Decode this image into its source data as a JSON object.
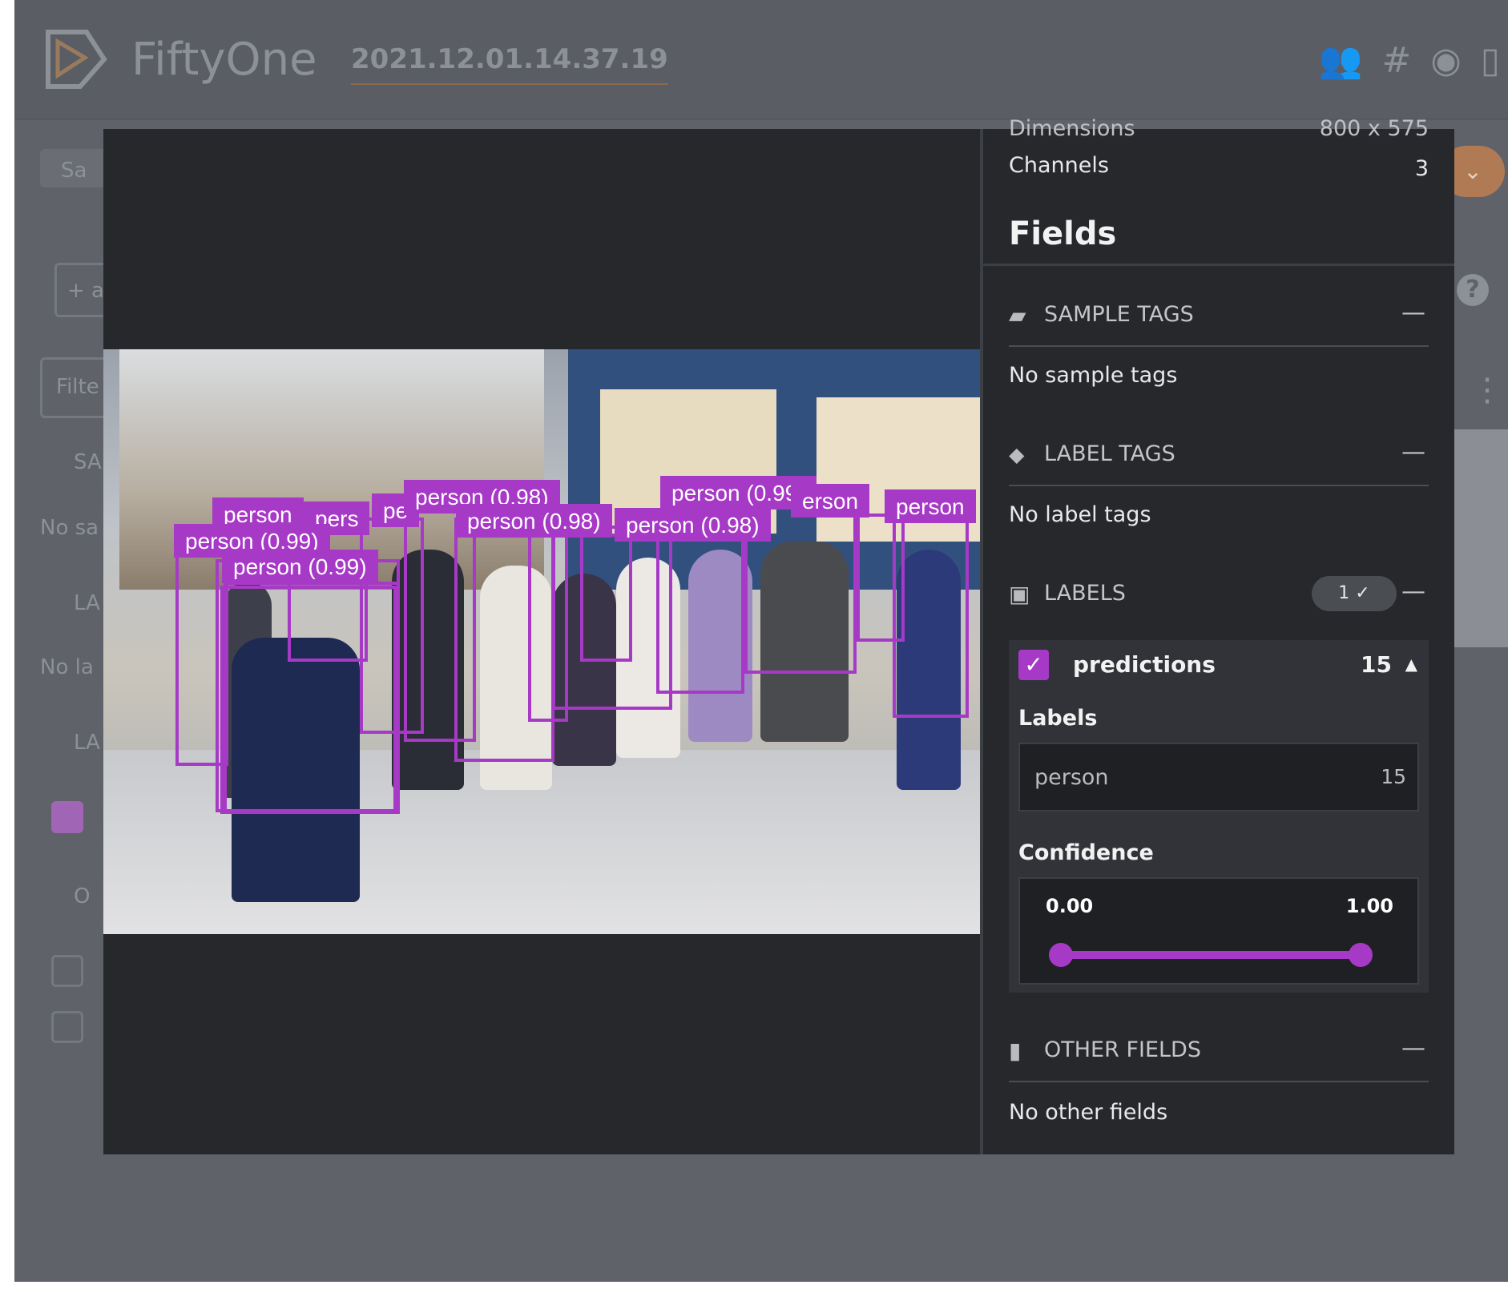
{
  "header": {
    "brand": "FiftyOne",
    "dataset_name": "2021.12.01.14.37.19",
    "icons": [
      "team-icon",
      "slack-icon",
      "github-icon",
      "docs-icon"
    ]
  },
  "background": {
    "search_fragment": "Sa",
    "add_fragment": "+ a",
    "filter_fragment": "Filte",
    "sample_tags_fragment": "SA",
    "no_sample_fragment": "No sa",
    "label_fragment": "LA",
    "no_label_fragment": "No la",
    "labels_fragment": "LA",
    "other_fragment": "O"
  },
  "detections": [
    {
      "label": "person (0.98)"
    },
    {
      "label": "person (0.99)"
    },
    {
      "label": "person (0.99)"
    },
    {
      "label": "person (0.98)"
    },
    {
      "label": "person (0.98)"
    },
    {
      "label": "erson"
    },
    {
      "label": "person"
    },
    {
      "label": "person"
    },
    {
      "label": "pers"
    },
    {
      "label": "pe"
    },
    {
      "label": "person (0.99)"
    }
  ],
  "sidebar": {
    "dimensions_label": "Dimensions",
    "dimensions_value": "800 x 575",
    "channels_label": "Channels",
    "channels_value": "3",
    "fields_title": "Fields",
    "sample_tags_title": "SAMPLE TAGS",
    "sample_tags_empty": "No sample tags",
    "label_tags_title": "LABEL TAGS",
    "label_tags_empty": "No label tags",
    "labels_title": "LABELS",
    "labels_badge": "1 ✓",
    "predictions": {
      "name": "predictions",
      "count": "15",
      "labels_heading": "Labels",
      "label_value": "person",
      "label_count": "15",
      "confidence_heading": "Confidence",
      "confidence_min": "0.00",
      "confidence_max": "1.00",
      "range": [
        0.0,
        1.0
      ]
    },
    "other_fields_title": "OTHER FIELDS",
    "other_fields_empty": "No other fields",
    "minus": "—"
  },
  "colors": {
    "accent": "#a739c7",
    "panel": "#26282c",
    "backdrop": "#5f6369"
  }
}
